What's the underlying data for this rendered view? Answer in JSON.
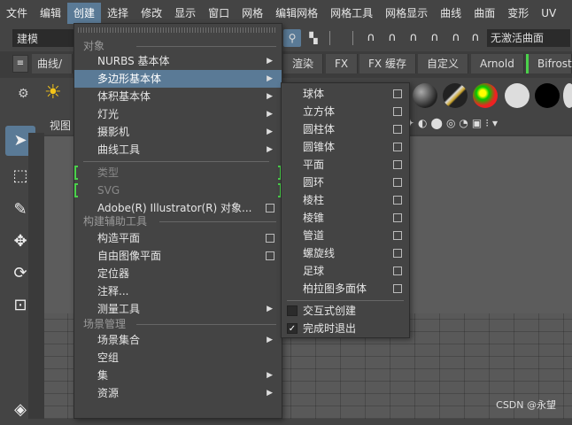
{
  "menubar": {
    "items": [
      "文件",
      "编辑",
      "创建",
      "选择",
      "修改",
      "显示",
      "窗口",
      "网格",
      "编辑网格",
      "网格工具",
      "网格显示",
      "曲线",
      "曲面",
      "变形",
      "UV"
    ],
    "active_index": 2
  },
  "toolbar": {
    "mode": "建模",
    "live_surface": "无激活曲面"
  },
  "shelf": {
    "tabs": [
      "曲线/",
      "渲染",
      "FX",
      "FX 缓存",
      "自定义",
      "Arnold",
      "Bifrost"
    ]
  },
  "viewport": {
    "label": "视图"
  },
  "create_menu": {
    "sections": {
      "objects": "对象",
      "construction": "构建辅助工具",
      "scene": "场景管理"
    },
    "items": {
      "nurbs": "NURBS 基本体",
      "polygon": "多边形基本体",
      "volume": "体积基本体",
      "lights": "灯光",
      "cameras": "摄影机",
      "curve_tools": "曲线工具",
      "type": "类型",
      "svg": "SVG",
      "illustrator": "Adobe(R) Illustrator(R) 对象...",
      "construction_plane": "构造平面",
      "free_image_plane": "自由图像平面",
      "locator": "定位器",
      "annotation": "注释...",
      "measure_tools": "测量工具",
      "scene_assembly": "场景集合",
      "empty_group": "空组",
      "sets": "集",
      "assets": "资源"
    }
  },
  "polygon_submenu": {
    "items": [
      "球体",
      "立方体",
      "圆柱体",
      "圆锥体",
      "平面",
      "圆环",
      "棱柱",
      "棱锥",
      "管道",
      "螺旋线",
      "足球",
      "柏拉图多面体"
    ],
    "interactive": "交互式创建",
    "exit_on_complete": "完成时退出",
    "interactive_checked": false,
    "exit_checked": true
  },
  "watermark": "CSDN @永望"
}
